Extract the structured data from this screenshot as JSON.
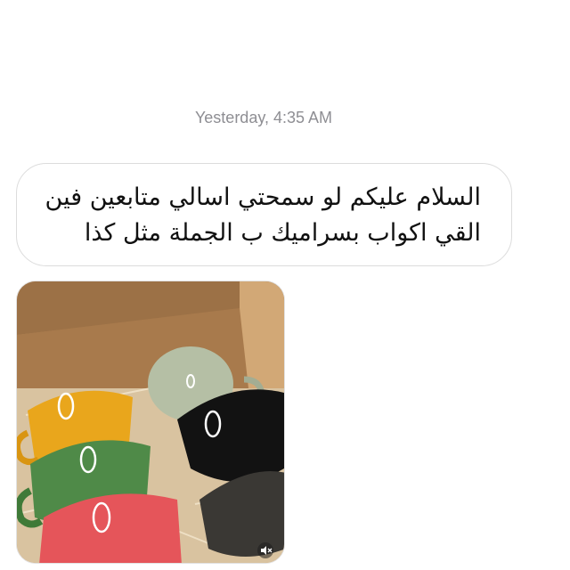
{
  "conversation": {
    "timestamp": "Yesterday, 4:35 AM",
    "message": {
      "line1": "السلام عليكم لو سمحتي اسالي متابعين فين",
      "line2": "القي اكواب بسراميك ب الجملة مثل كذا"
    },
    "attachment": {
      "kind": "video",
      "icons": [
        "mute-icon"
      ]
    }
  },
  "colors": {
    "bubble_border": "#dcdcdc",
    "timestamp": "#8e8e93",
    "text": "#111111"
  }
}
